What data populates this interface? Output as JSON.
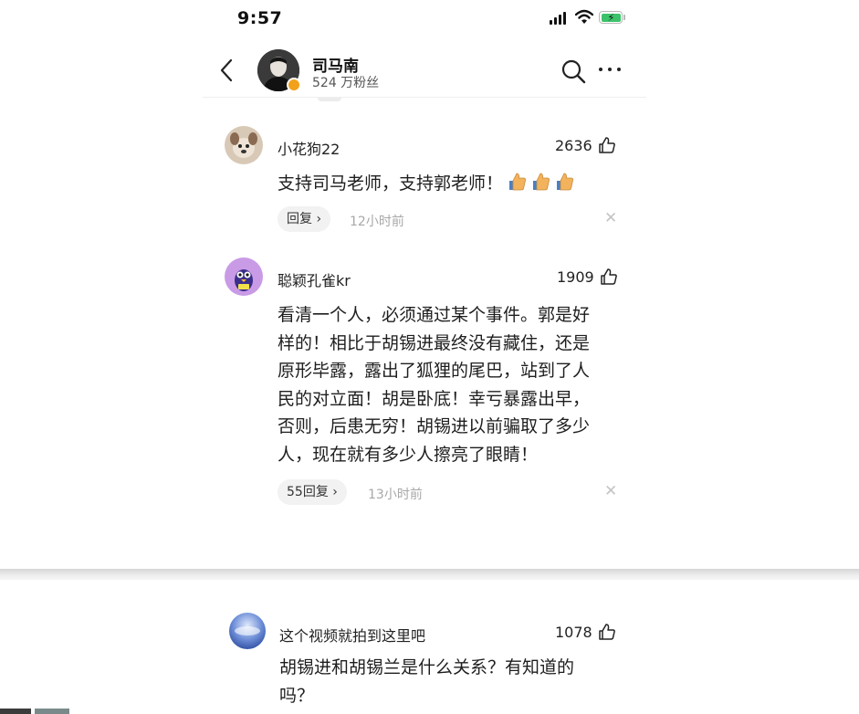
{
  "status_bar": {
    "time": "9:57"
  },
  "header": {
    "name": "司马南",
    "fans": "524 万粉丝"
  },
  "comments": [
    {
      "username": "小花狗22",
      "likes": "2636",
      "content": "支持司马老师，支持郭老师！",
      "reply_label": "回复 ›",
      "time": "12小时前"
    },
    {
      "username": "聪颖孔雀kr",
      "likes": "1909",
      "lines": [
        "看清一个人，必须通过某个事件。郭是好",
        "样的！相比于胡锡进最终没有藏住，还是",
        "原形毕露，露出了狐狸的尾巴，站到了人",
        "民的对立面！胡是卧底！幸亏暴露出早，",
        "否则，后患无穷！胡锡进以前骗取了多少",
        "人，现在就有多少人擦亮了眼睛！"
      ],
      "reply_label": "55回复 ›",
      "time": "13小时前"
    },
    {
      "username": "这个视频就拍到这里吧",
      "likes": "1078",
      "lines": [
        "胡锡进和胡锡兰是什么关系？有知道的",
        "吗？"
      ]
    }
  ],
  "icons": {
    "back": "chevron-left-icon",
    "search": "search-icon",
    "more": "more-icon",
    "like": "thumbs-up-icon",
    "close": "close-icon"
  },
  "colors": {
    "battery": "#3cc26a",
    "verified_badge": "#f2a21a",
    "muted_text": "#a8a8a8"
  }
}
